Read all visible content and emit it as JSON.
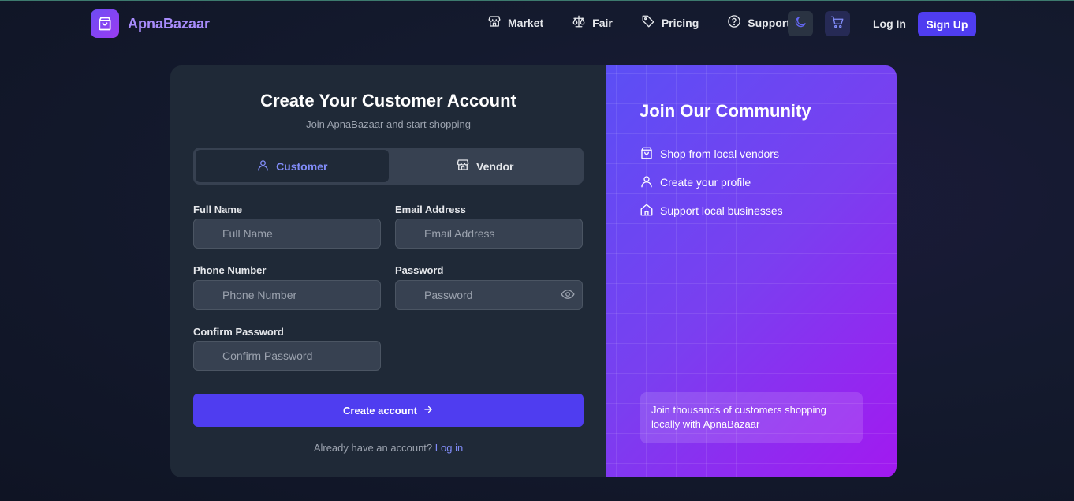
{
  "brand": {
    "name": "ApnaBazaar",
    "logo_icon": "shopping-bag-icon"
  },
  "nav": {
    "links": [
      {
        "label": "Market",
        "icon": "store-icon"
      },
      {
        "label": "Fair",
        "icon": "scale-icon"
      },
      {
        "label": "Pricing",
        "icon": "tag-icon"
      },
      {
        "label": "Support",
        "icon": "help-circle-icon"
      }
    ],
    "theme_icon": "moon-icon",
    "cart_icon": "cart-icon",
    "login_label": "Log In",
    "signup_label": "Sign Up"
  },
  "form": {
    "title": "Create Your Customer Account",
    "subtitle": "Join ApnaBazaar and start shopping",
    "account_types": [
      {
        "label": "Customer",
        "icon": "user-icon",
        "active": true
      },
      {
        "label": "Vendor",
        "icon": "store-icon",
        "active": false
      }
    ],
    "fields": {
      "full_name": {
        "label": "Full Name",
        "placeholder": "Full Name",
        "value": ""
      },
      "email": {
        "label": "Email Address",
        "placeholder": "Email Address",
        "value": ""
      },
      "phone": {
        "label": "Phone Number",
        "placeholder": "Phone Number",
        "value": ""
      },
      "password": {
        "label": "Password",
        "placeholder": "Password",
        "value": "",
        "toggle_icon": "eye-icon"
      },
      "confirm_password": {
        "label": "Confirm Password",
        "placeholder": "Confirm Password",
        "value": ""
      }
    },
    "submit_label": "Create account",
    "submit_icon": "arrow-right-icon",
    "login_prompt": "Already have an account?",
    "login_link": "Log in"
  },
  "promo": {
    "title": "Join Our Community",
    "items": [
      {
        "label": "Shop from local vendors",
        "icon": "shopping-bag-icon"
      },
      {
        "label": "Create your profile",
        "icon": "user-icon"
      },
      {
        "label": "Support local businesses",
        "icon": "home-icon"
      }
    ],
    "note": "Join thousands of customers shopping locally with ApnaBazaar"
  },
  "colors": {
    "accent": "#4f3df0",
    "accent_text": "#818cf8",
    "brand_text": "#a78bfa",
    "panel": "#1f2937",
    "promo_gradient_start": "#5b4ff5",
    "promo_gradient_end": "#a219f0"
  }
}
